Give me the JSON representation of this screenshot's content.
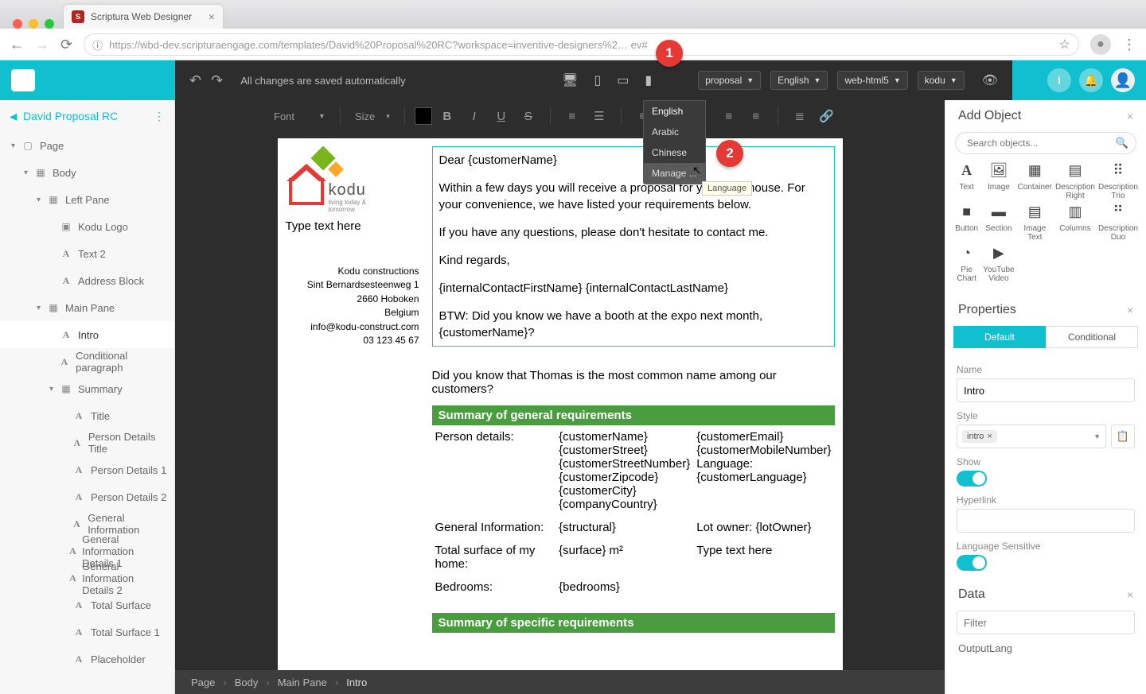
{
  "browser": {
    "tab_title": "Scriptura Web Designer",
    "url": "https://wbd-dev.scripturaengage.com/templates/David%20Proposal%20RC?workspace=inventive-designers%2…         ev#"
  },
  "topbar": {
    "autosave": "All changes are saved automatically",
    "dropdowns": {
      "template": "proposal",
      "language": "English",
      "output": "web-html5",
      "brand": "kodu"
    },
    "language_menu": [
      "English",
      "Arabic",
      "Chinese",
      "Manage ..."
    ],
    "language_tooltip": "Language"
  },
  "formatbar": {
    "font_label": "Font",
    "size_label": "Size"
  },
  "callouts": {
    "one": "1",
    "two": "2"
  },
  "template_name": "David Proposal RC",
  "tree": {
    "page": "Page",
    "body": "Body",
    "left_pane": "Left Pane",
    "kodu_logo": "Kodu Logo",
    "text2": "Text 2",
    "address_block": "Address Block",
    "main_pane": "Main Pane",
    "intro": "Intro",
    "conditional_paragraph": "Conditional paragraph",
    "summary": "Summary",
    "title": "Title",
    "person_details_title": "Person Details Title",
    "person_details_1": "Person Details 1",
    "person_details_2": "Person Details 2",
    "general_information": "General Information",
    "general_information_details_1": "General Information Details 1",
    "general_information_details_2": "General Information Details 2",
    "total_surface": "Total Surface",
    "total_surface_1": "Total Surface 1",
    "placeholder": "Placeholder"
  },
  "doc": {
    "logo_name": "kodu",
    "logo_tag": "living today & tomorrow",
    "type_here": "Type text here",
    "addr": [
      "Kodu constructions",
      "Sint Bernardsesteenweg 1",
      "2660 Hoboken",
      "Belgium",
      "info@kodu-construct.com",
      "03 123 45 67"
    ],
    "intro": {
      "greeting": "Dear {customerName}",
      "p1": "Within a few days you will receive a proposal for your new house. For your convenience, we have listed your requirements below.",
      "p2": "If you have any questions, please don't hesitate to contact me.",
      "signoff": "Kind regards,",
      "sig": "{internalContactFirstName} {internalContactLastName}",
      "btw": "BTW: Did you know we have a booth at the expo next month, {customerName}?"
    },
    "fact": "Did you know that Thomas is the most common name among our customers?",
    "summary_hdr": "Summary of general requirements",
    "person_details_label": "Person details:",
    "person_col1": [
      "{customerName}",
      "{customerStreet}",
      "{customerStreetNumber}",
      "{customerZipcode}",
      "{customerCity}",
      "{companyCountry}"
    ],
    "person_col2": [
      "{customerEmail}",
      "{customerMobileNumber}",
      "Language:",
      " {customerLanguage}"
    ],
    "geninfo_label": "General Information:",
    "geninfo_c1": "{structural}",
    "geninfo_c2": "Lot owner: {lotOwner}",
    "surface_label": "Total surface of my home:",
    "surface_c1": "{surface} m²",
    "surface_c2": "Type text here",
    "bedrooms_label": "Bedrooms:",
    "bedrooms_c1": "{bedrooms}",
    "specific_hdr": "Summary of specific requirements"
  },
  "breadcrumb": [
    "Page",
    "Body",
    "Main Pane",
    "Intro"
  ],
  "right": {
    "add_object": "Add Object",
    "search_placeholder": "Search objects...",
    "objects": [
      "Text",
      "Image",
      "Container",
      "Description Right",
      "Description Trio",
      "Button",
      "Section",
      "Image Text",
      "Columns",
      "Description Duo",
      "Pie Chart",
      "YouTube Video"
    ],
    "properties": "Properties",
    "tab_default": "Default",
    "tab_conditional": "Conditional",
    "name_label": "Name",
    "name_value": "Intro",
    "style_label": "Style",
    "style_chip": "intro",
    "show_label": "Show",
    "hyperlink_label": "Hyperlink",
    "langsens_label": "Language Sensitive",
    "data": "Data",
    "filter_placeholder": "Filter",
    "data_item1": "OutputLang"
  }
}
